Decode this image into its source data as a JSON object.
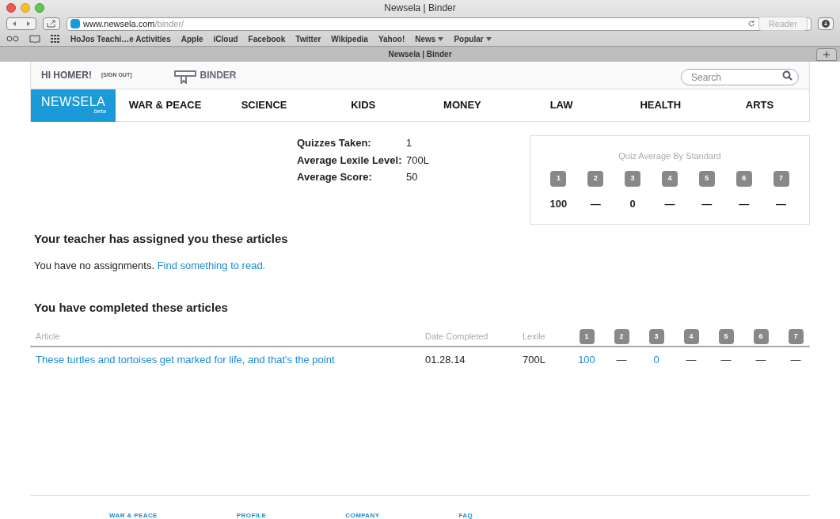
{
  "window": {
    "title": "Newsela | Binder"
  },
  "address_bar": {
    "domain": "www.newsela.com",
    "path": "/binder/",
    "reader": "Reader"
  },
  "bookmarks": [
    {
      "label": "HoJos Teachi…e Activities",
      "menu": false
    },
    {
      "label": "Apple",
      "menu": false
    },
    {
      "label": "iCloud",
      "menu": false
    },
    {
      "label": "Facebook",
      "menu": false
    },
    {
      "label": "Twitter",
      "menu": false
    },
    {
      "label": "Wikipedia",
      "menu": false
    },
    {
      "label": "Yahoo!",
      "menu": false
    },
    {
      "label": "News",
      "menu": true
    },
    {
      "label": "Popular",
      "menu": true
    }
  ],
  "tab": {
    "title": "Newsela | Binder"
  },
  "header": {
    "greeting": "HI HOMER!",
    "sign_out": "[SIGN OUT]",
    "binder": "BINDER",
    "search": {
      "placeholder": "Search"
    }
  },
  "nav": {
    "logo": "NEWSELA",
    "logo_sub": "beta",
    "items": [
      "WAR & PEACE",
      "SCIENCE",
      "KIDS",
      "MONEY",
      "LAW",
      "HEALTH",
      "ARTS"
    ]
  },
  "stats": [
    {
      "label": "Quizzes Taken:",
      "value": "1"
    },
    {
      "label": "Average Lexile Level:",
      "value": "700L"
    },
    {
      "label": "Average Score:",
      "value": "50"
    }
  ],
  "quiz_average": {
    "title": "Quiz Average By Standard",
    "standards": [
      {
        "number": "1",
        "value": "100"
      },
      {
        "number": "2",
        "value": "—"
      },
      {
        "number": "3",
        "value": "0"
      },
      {
        "number": "4",
        "value": "—"
      },
      {
        "number": "5",
        "value": "—"
      },
      {
        "number": "6",
        "value": "—"
      },
      {
        "number": "7",
        "value": "—"
      }
    ]
  },
  "assigned": {
    "heading": "Your teacher has assigned you these articles",
    "text": "You have no assignments.",
    "link": "Find something to read."
  },
  "completed": {
    "heading": "You have completed these articles",
    "columns": [
      "Article",
      "Date Completed",
      "Lexile",
      "1",
      "2",
      "3",
      "4",
      "5",
      "6",
      "7"
    ],
    "rows": [
      {
        "article": "These turtles and tortoises get marked for life, and that's the point",
        "date": "01.28.14",
        "lexile": "700L",
        "scores": [
          {
            "value": "100",
            "link": true
          },
          {
            "value": "—",
            "link": false
          },
          {
            "value": "0",
            "link": true
          },
          {
            "value": "—",
            "link": false
          },
          {
            "value": "—",
            "link": false
          },
          {
            "value": "—",
            "link": false
          },
          {
            "value": "—",
            "link": false
          }
        ]
      }
    ]
  },
  "footer": [
    "WAR & PEACE",
    "PROFILE",
    "COMPANY",
    "FAQ"
  ]
}
